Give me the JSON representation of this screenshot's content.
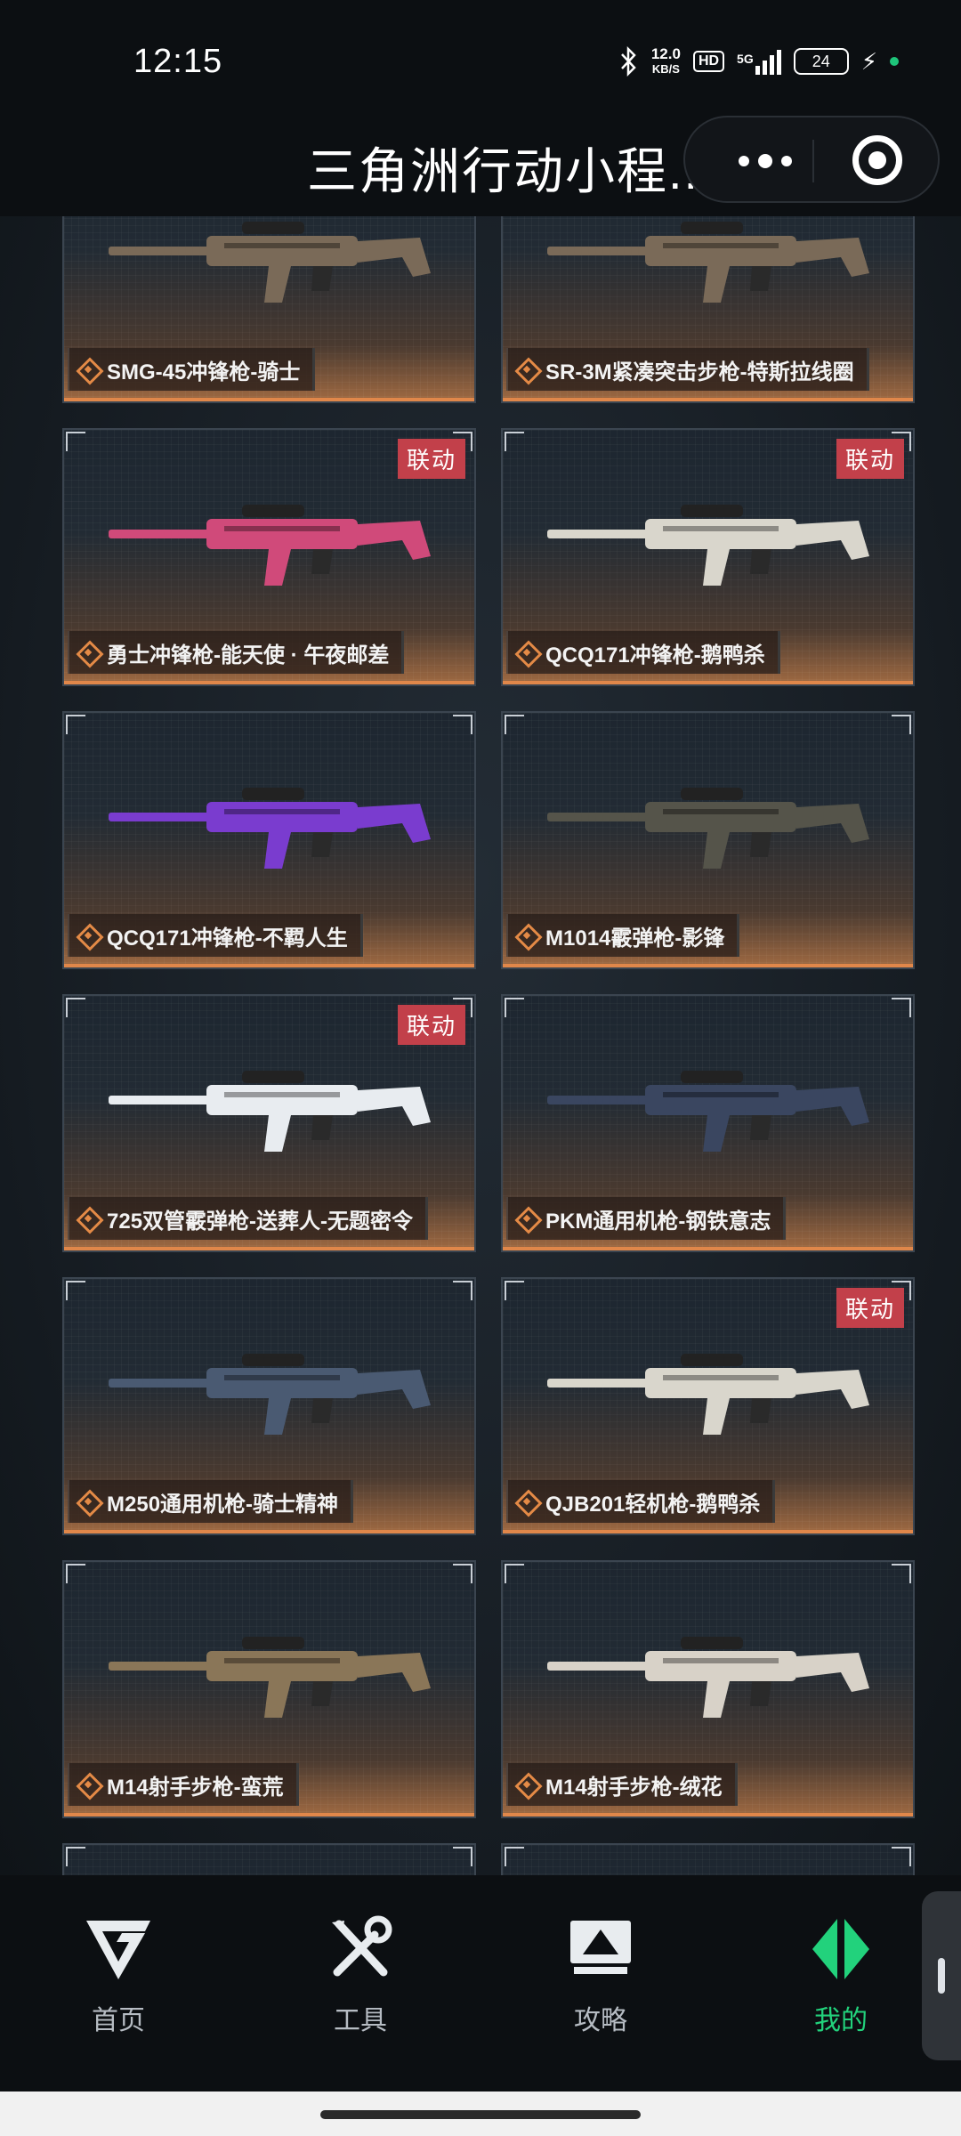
{
  "status_bar": {
    "time": "12:15",
    "speed_value": "12.0",
    "speed_unit": "KB/S",
    "hd": "HD",
    "network": "5G",
    "battery": "24"
  },
  "header": {
    "title": "三角洲行动小程..."
  },
  "cards": [
    {
      "name": "SMG-45冲锋枪-骑士",
      "badge": "",
      "gun_color": "#7a6a58"
    },
    {
      "name": "SR-3M紧凑突击步枪-特斯拉线圈",
      "badge": "",
      "gun_color": "#7a6a58"
    },
    {
      "name": "勇士冲锋枪-能天使 · 午夜邮差",
      "badge": "联动",
      "gun_color": "#d04a7a"
    },
    {
      "name": "QCQ171冲锋枪-鹅鸭杀",
      "badge": "联动",
      "gun_color": "#d9d6cc"
    },
    {
      "name": "QCQ171冲锋枪-不羁人生",
      "badge": "",
      "gun_color": "#7a3ccf"
    },
    {
      "name": "M1014霰弹枪-影锋",
      "badge": "",
      "gun_color": "#55544a"
    },
    {
      "name": "725双管霰弹枪-送葬人-无题密令",
      "badge": "联动",
      "gun_color": "#e8ecf0"
    },
    {
      "name": "PKM通用机枪-钢铁意志",
      "badge": "",
      "gun_color": "#3a4660"
    },
    {
      "name": "M250通用机枪-骑士精神",
      "badge": "",
      "gun_color": "#4a5a72"
    },
    {
      "name": "QJB201轻机枪-鹅鸭杀",
      "badge": "联动",
      "gun_color": "#d9d6cc"
    },
    {
      "name": "M14射手步枪-蛮荒",
      "badge": "",
      "gun_color": "#8a7658"
    },
    {
      "name": "M14射手步枪-绒花",
      "badge": "",
      "gun_color": "#d8d2c8"
    },
    {
      "name": "",
      "badge": "",
      "gun_color": "#c8ccd2"
    },
    {
      "name": "",
      "badge": "",
      "gun_color": "#b8a48a"
    }
  ],
  "nav": {
    "items": [
      {
        "label": "首页",
        "icon": "home-logo-icon"
      },
      {
        "label": "工具",
        "icon": "tools-icon"
      },
      {
        "label": "攻略",
        "icon": "guide-monitor-icon"
      },
      {
        "label": "我的",
        "icon": "profile-icon"
      }
    ],
    "active_color": "#22d27c"
  }
}
